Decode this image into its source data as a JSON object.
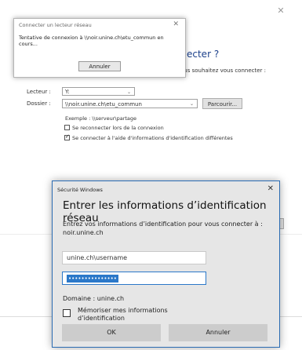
{
  "background_dialog": {
    "heading": "ecter ?",
    "instruction": "s vous souhaitez vous connecter :",
    "drive_label": "Lecteur :",
    "drive_value": "Y:",
    "folder_label": "Dossier :",
    "folder_value": "\\\\noir.unine.ch\\etu_commun",
    "browse_label": "Parcourir...",
    "example": "Exemple : \\\\serveur\\partage",
    "reconnect_label": "Se reconnecter lors de la connexion",
    "other_credentials_label": "Se connecter à l'aide d'informations d'identification différentes"
  },
  "progress_popup": {
    "title": "Connecter un lecteur réseau",
    "message": "Tentative de connexion à \\\\noir.unine.ch\\etu_commun en cours...",
    "cancel_label": "Annuler"
  },
  "security_dialog": {
    "title": "Sécurité Windows",
    "heading": "Entrer les informations d’identification réseau",
    "description": "Entrez vos informations d’identification pour vous connecter à : noir.unine.ch",
    "username_value": "unine.ch\\username",
    "password_mask": "•••••••••••••••",
    "domain_text": "Domaine : unine.ch",
    "remember_label": "Mémoriser mes informations d’identification",
    "ok_label": "OK",
    "cancel_label": "Annuler"
  }
}
